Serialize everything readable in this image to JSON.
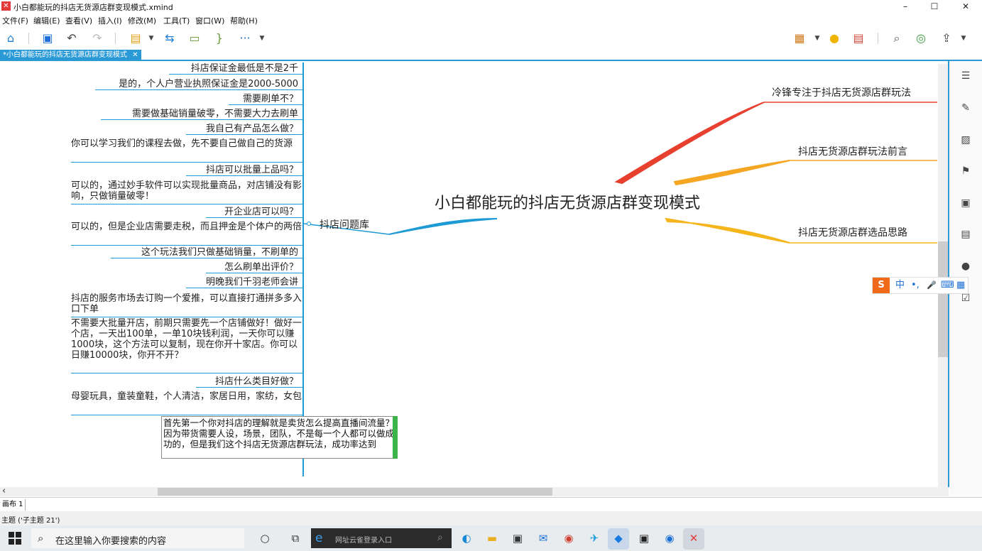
{
  "window": {
    "title": "小白都能玩的抖店无货源店群变现模式.xmind",
    "minimize": "–",
    "maximize": "☐",
    "close": "✕"
  },
  "menu": [
    "文件(F)",
    "编辑(E)",
    "查看(V)",
    "插入(I)",
    "修改(M)",
    "工具(T)",
    "窗口(W)",
    "帮助(H)"
  ],
  "toolbar": {
    "left_icons": [
      "home-icon",
      "save-icon",
      "undo-icon",
      "redo-icon",
      "topic-style-icon",
      "relationship-icon",
      "boundary-icon",
      "summary-icon",
      "more-icon"
    ],
    "right_icons": [
      "presentation-icon",
      "brainstorm-icon",
      "gantt-icon",
      "search-icon",
      "share-icon",
      "export-icon"
    ],
    "more_label": "···"
  },
  "document_tab": {
    "label": "*小白都能玩的抖店无货源店群变现模式",
    "close": "✕"
  },
  "map": {
    "central_topic": "小白都能玩的抖店无货源店群变现模式",
    "right_topics": [
      "冷锋专注于抖店无货源店群玩法",
      "抖店无货源店群玩法前言",
      "抖店无货源店群选品思路"
    ],
    "left_topic": "抖店问题库",
    "subtopics": [
      "抖店保证金最低是不是2千",
      "是的，个人户营业执照保证金是2000-5000",
      "需要刷单不？",
      "需要做基础销量破零，不需要大力去刷单",
      "我自己有产品怎么做？",
      "你可以学习我们的课程去做，先不要自己做自己的货源",
      "抖店可以批量上品吗？",
      "可以的，通过妙手软件可以实现批量商品，对店铺没有影响，只做销量破零！",
      "开企业店可以吗？",
      "可以的，但是企业店需要走税，而且押金是个体户的两倍",
      "这个玩法我们只做基础销量，不刷单的",
      "怎么刷单出评价？",
      "明晚我们千羽老师会讲",
      "抖店的服务市场去订购一个爱推，可以直接打通拼多多入口下单",
      "不需要大批量开店，前期只需要先一个店铺做好！做好一个店，一天出100单，一单10块钱利润，一天你可以赚1000块，这个方法可以复制，现在你开十家店。你可以日赚10000块，你开不开？",
      "抖店什么类目好做？",
      "母婴玩具，童装童鞋，个人清洁，家居日用，家纺，女包"
    ],
    "editing_text": "首先第一个你对抖店的理解就是卖货怎么提高直播间流量？因为带货需要人设，场景，团队，不是每一个人都可以做成功的，但是我们这个抖店无货源店群玩法，成功率达到",
    "branch_colors": {
      "left": "#1e9ad6",
      "right1": "#e8402f",
      "right2": "#f5a623",
      "right3": "#f5b51c"
    }
  },
  "right_panel_icons": [
    "outline-icon",
    "format-icon",
    "image-icon",
    "marker-icon",
    "sticker-icon",
    "notes-icon",
    "comment-icon",
    "task-icon"
  ],
  "ime": {
    "logo": "S",
    "mode": "中",
    "punct": "•,",
    "mic": "🎤",
    "keyboard": "⌨",
    "grid": "▦"
  },
  "sheet_tab": "画布 1",
  "status": "主题 ('子主题 21')",
  "taskbar": {
    "search_placeholder": "在这里输入你要搜索的内容",
    "address_placeholder": "网址云雀登录入口",
    "apps": [
      "cortana-icon",
      "task-view-icon",
      "ie-browser-icon",
      "edge-icon",
      "file-explorer-icon",
      "store-icon",
      "mail-icon",
      "chrome-icon",
      "twitter-icon",
      "feishu-icon",
      "video-icon",
      "browser-icon",
      "xmind-icon"
    ]
  },
  "scroll_left_arrow": "‹"
}
